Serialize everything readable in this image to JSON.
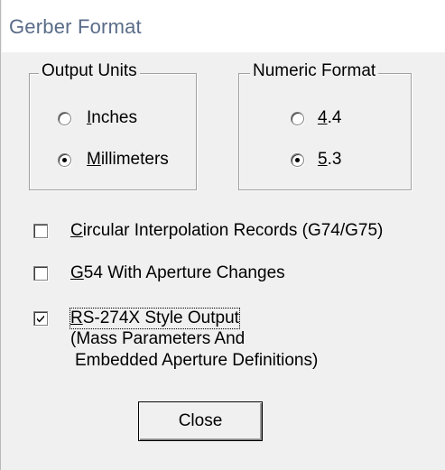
{
  "window": {
    "title": "Gerber Format"
  },
  "output_units": {
    "legend": "Output Units",
    "options": [
      {
        "label": "Inches",
        "mnemonic": "I",
        "rest": "nches",
        "selected": false
      },
      {
        "label": "Millimeters",
        "mnemonic": "M",
        "rest": "illimeters",
        "selected": true
      }
    ]
  },
  "numeric_format": {
    "legend": "Numeric Format",
    "options": [
      {
        "label": "4.4",
        "mnemonic": "4",
        "rest": ".4",
        "selected": false
      },
      {
        "label": "5.3",
        "mnemonic": "5",
        "rest": ".3",
        "selected": true
      }
    ]
  },
  "options": {
    "circular": {
      "label": "Circular Interpolation Records (G74/G75)",
      "mnemonic": "C",
      "rest": "ircular Interpolation Records (G74/G75)",
      "checked": false
    },
    "g54": {
      "label": "G54 With Aperture Changes",
      "mnemonic": "G",
      "rest": "54 With Aperture Changes",
      "checked": false
    },
    "rs274x": {
      "label": "RS-274X Style Output",
      "mnemonic": "R",
      "rest": "S-274X Style Output",
      "checked": true,
      "note_line1": "(Mass Parameters And",
      "note_line2": "Embedded Aperture Definitions)"
    }
  },
  "close_button": {
    "label": "Close"
  }
}
